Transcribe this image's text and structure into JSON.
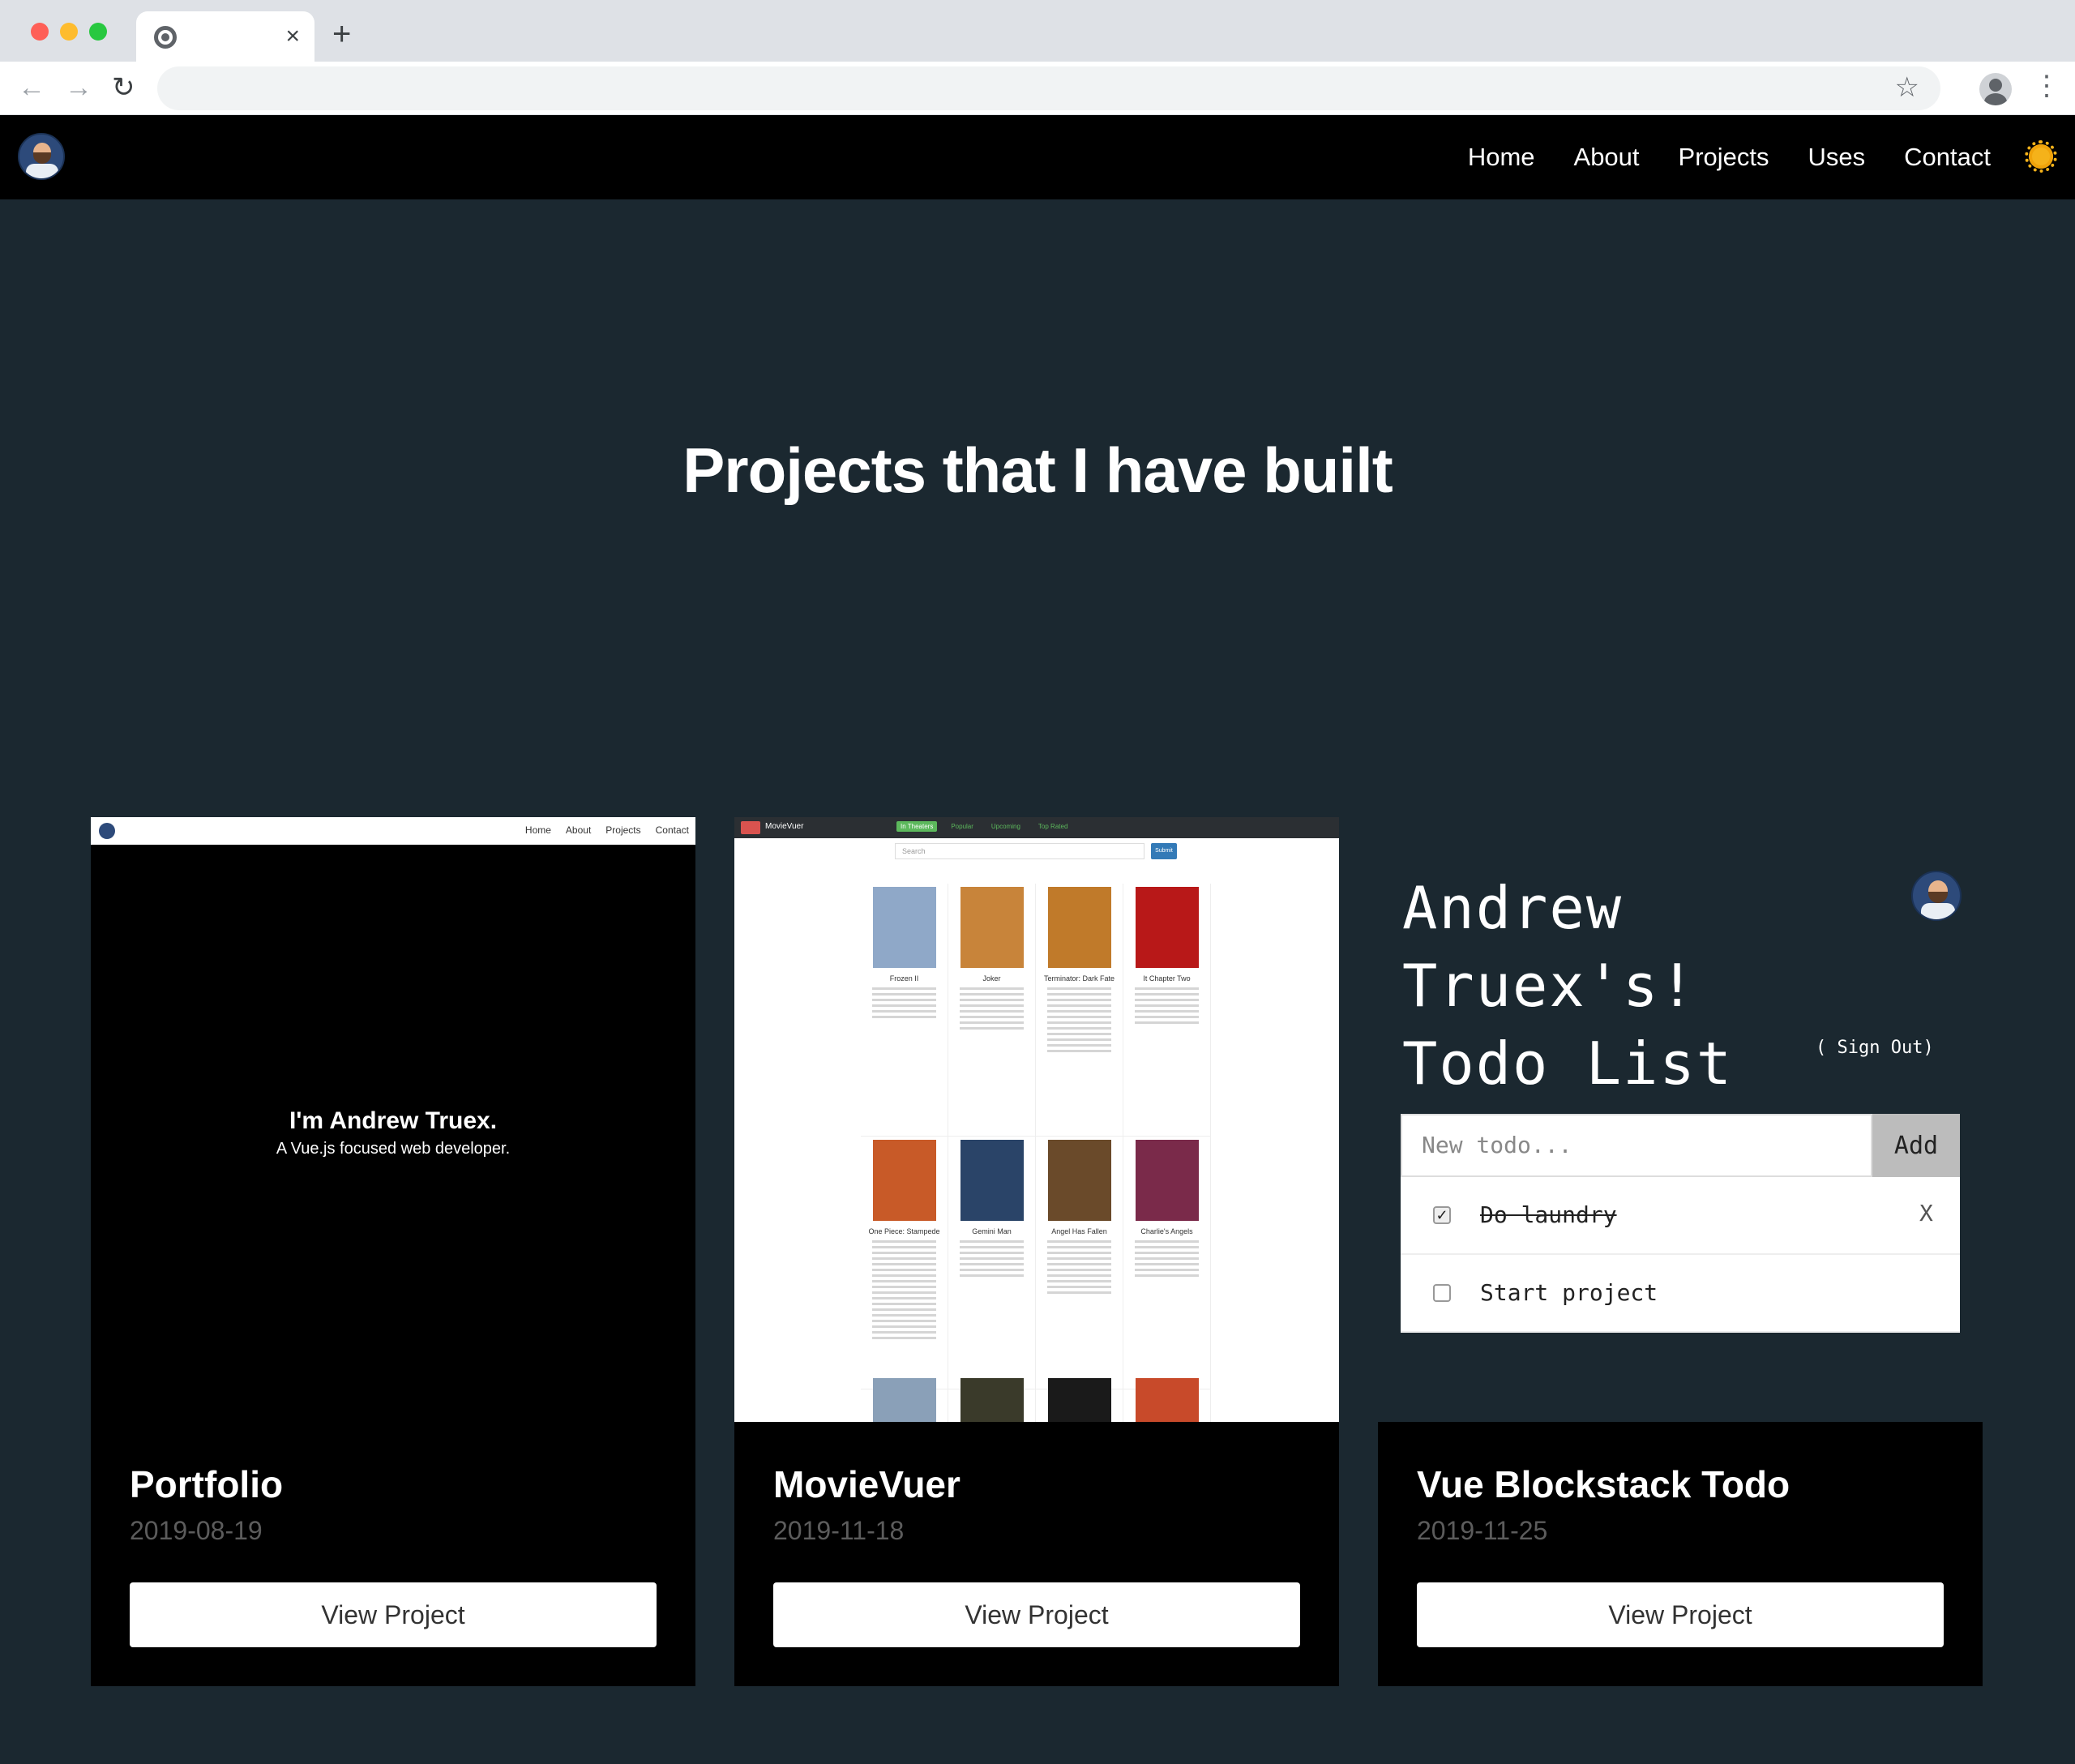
{
  "browser": {
    "tab_close": "×",
    "new_tab": "+",
    "back": "←",
    "forward": "→",
    "reload": "↻",
    "star": "☆",
    "menu": "⋮"
  },
  "nav": {
    "links": [
      "Home",
      "About",
      "Projects",
      "Uses",
      "Contact"
    ]
  },
  "hero": {
    "title": "Projects that I have built"
  },
  "cards": [
    {
      "title": "Portfolio",
      "date": "2019-08-19",
      "button": "View Project",
      "preview": {
        "nav_links": [
          "Home",
          "About",
          "Projects",
          "Contact"
        ],
        "name": "I'm Andrew Truex.",
        "subtitle": "A Vue.js focused web developer."
      }
    },
    {
      "title": "MovieVuer",
      "date": "2019-11-18",
      "button": "View Project",
      "preview": {
        "brand": "MovieVuer",
        "tabs": [
          "In Theaters",
          "Popular",
          "Upcoming",
          "Top Rated"
        ],
        "search_placeholder": "Search",
        "submit": "Submit",
        "movies": [
          "Frozen II",
          "Joker",
          "Terminator: Dark Fate",
          "It Chapter Two",
          "One Piece: Stampede",
          "Gemini Man",
          "Angel Has Fallen",
          "Charlie's Angels"
        ],
        "poster_colors": [
          "#8fa8c8",
          "#c8843a",
          "#c07a2a",
          "#b81818",
          "#c85a28",
          "#2a4468",
          "#6a4a2a",
          "#7a2a4a"
        ],
        "row3_colors": [
          "#8aa0b8",
          "#3a3a2a",
          "#1a1a1a",
          "#c84a2a"
        ]
      }
    },
    {
      "title": "Vue Blockstack Todo",
      "date": "2019-11-25",
      "button": "View Project",
      "preview": {
        "heading": "Andrew Truex's! Todo List",
        "signout": "( Sign Out)",
        "input_placeholder": "New todo...",
        "add": "Add",
        "items": [
          {
            "text": "Do laundry",
            "done": true,
            "remove": "X"
          },
          {
            "text": "Start project",
            "done": false
          }
        ]
      }
    }
  ],
  "colors": {
    "page_bg": "#1b2830",
    "nav_bg": "#000000",
    "card_bg": "#000000",
    "sun": "#f5b21a"
  }
}
